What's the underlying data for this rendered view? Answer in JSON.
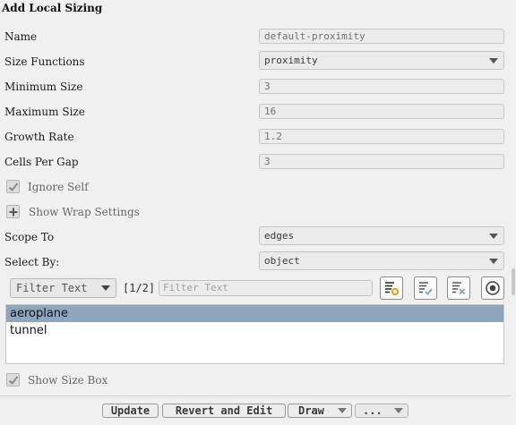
{
  "panel": {
    "title": "Add Local Sizing"
  },
  "fields": {
    "name": {
      "label": "Name",
      "value": "default-proximity"
    },
    "size_functions": {
      "label": "Size Functions",
      "value": "proximity"
    },
    "minimum_size": {
      "label": "Minimum Size",
      "value": "3"
    },
    "maximum_size": {
      "label": "Maximum Size",
      "value": "16"
    },
    "growth_rate": {
      "label": "Growth Rate",
      "value": "1.2"
    },
    "cells_per_gap": {
      "label": "Cells Per Gap",
      "value": "3"
    },
    "ignore_self": {
      "label": "Ignore Self",
      "checked": true
    },
    "show_wrap_settings": {
      "label": "Show Wrap Settings"
    },
    "scope_to": {
      "label": "Scope To",
      "value": "edges"
    },
    "select_by": {
      "label": "Select By:",
      "value": "object"
    }
  },
  "filter": {
    "mode": "Filter Text",
    "page_indicator": "[1/2]",
    "placeholder": "Filter Text"
  },
  "tools": [
    "select-filter-icon",
    "select-all-icon",
    "deselect-all-icon",
    "pick-target-icon"
  ],
  "list": {
    "items": [
      "aeroplane",
      "tunnel"
    ],
    "selected_index": 0
  },
  "show_size_box": {
    "label": "Show Size Box",
    "checked": true
  },
  "buttons": {
    "update": "Update",
    "revert_edit": "Revert and Edit",
    "draw": "Draw",
    "more": "..."
  },
  "colors": {
    "selection": "#8ea6bd",
    "background": "#f0f0f0"
  }
}
